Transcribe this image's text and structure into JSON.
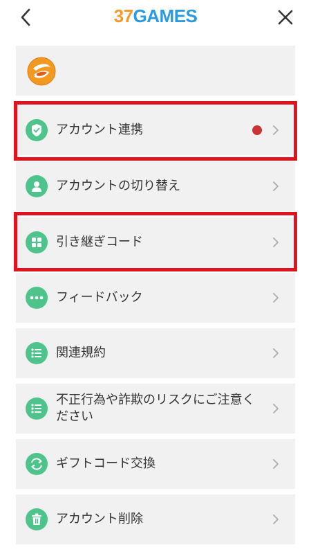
{
  "header": {
    "logo_num": "37",
    "logo_word": "GAMES"
  },
  "colors": {
    "accent_green": "#4ec48c",
    "highlight_red": "#e0141e",
    "notification_dot": "#cc3333",
    "logo_orange": "#f39a2e",
    "logo_blue": "#2a9be0"
  },
  "menu": {
    "items": [
      {
        "label": "アカウント連携",
        "icon": "shield-check-icon",
        "has_dot": true
      },
      {
        "label": "アカウントの切り替え",
        "icon": "person-icon",
        "has_dot": false
      },
      {
        "label": "引き継ぎコード",
        "icon": "grid-icon",
        "has_dot": false
      },
      {
        "label": "フィードバック",
        "icon": "dots-icon",
        "has_dot": false
      },
      {
        "label": "関連規約",
        "icon": "list-icon",
        "has_dot": false
      },
      {
        "label": "不正行為や詐欺のリスクにご注意ください",
        "icon": "list-icon",
        "has_dot": false
      },
      {
        "label": "ギフトコード交換",
        "icon": "exchange-icon",
        "has_dot": false
      },
      {
        "label": "アカウント削除",
        "icon": "trash-icon",
        "has_dot": false
      }
    ]
  }
}
